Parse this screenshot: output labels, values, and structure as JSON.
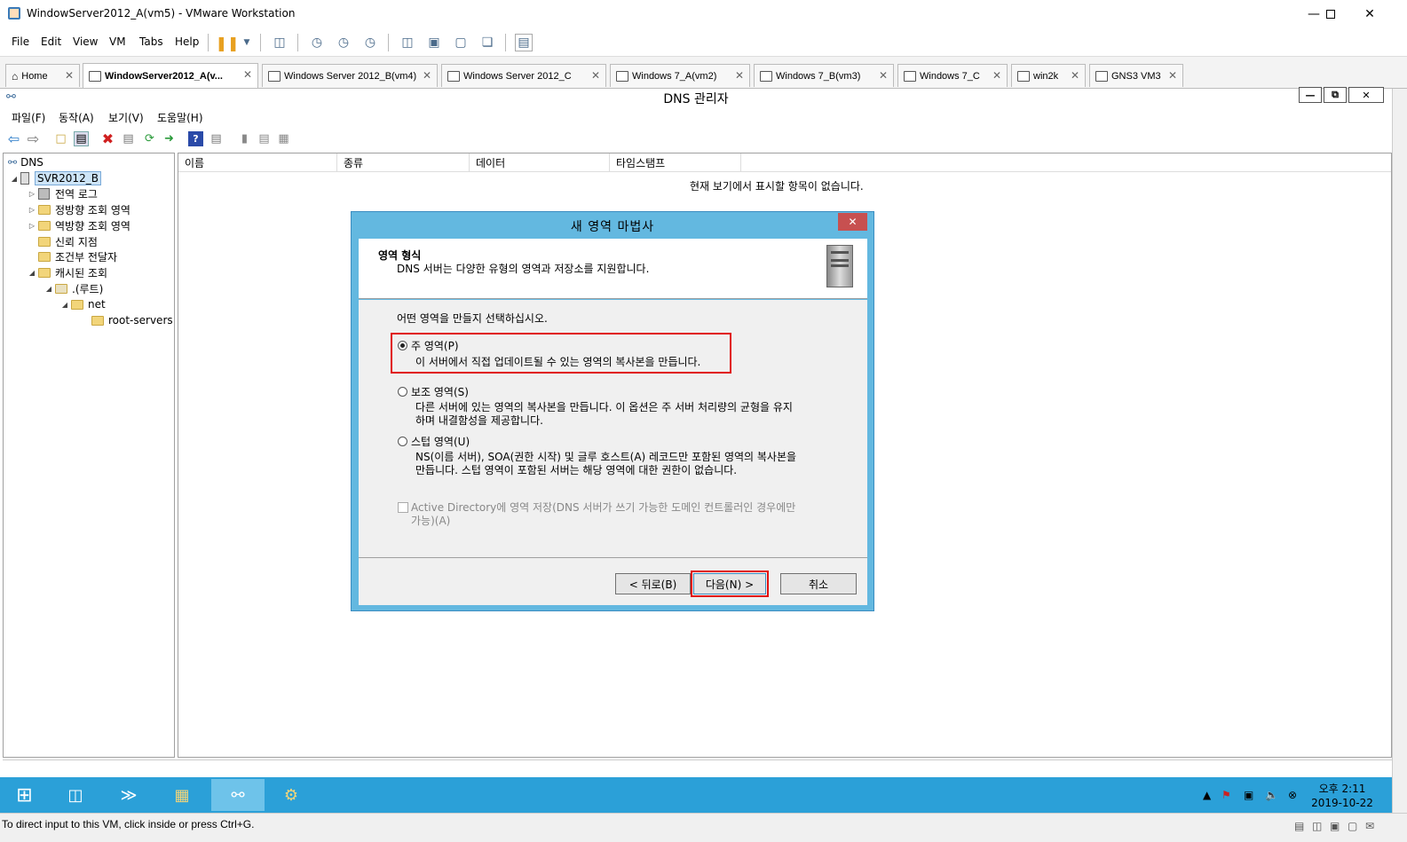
{
  "vmware": {
    "title": "WindowServer2012_A(vm5) - VMware Workstation",
    "menu": [
      "File",
      "Edit",
      "View",
      "VM",
      "Tabs",
      "Help"
    ],
    "tabs": [
      {
        "label": "Home"
      },
      {
        "label": "WindowServer2012_A(v..."
      },
      {
        "label": "Windows Server 2012_B(vm4)"
      },
      {
        "label": "Windows Server 2012_C"
      },
      {
        "label": "Windows 7_A(vm2)"
      },
      {
        "label": "Windows 7_B(vm3)"
      },
      {
        "label": "Windows 7_C"
      },
      {
        "label": "win2k"
      },
      {
        "label": "GNS3 VM3"
      }
    ],
    "status_text": "To direct input to this VM, click inside or press Ctrl+G."
  },
  "guest": {
    "window_title": "DNS 관리자",
    "menu": [
      "파일(F)",
      "동작(A)",
      "보기(V)",
      "도움말(H)"
    ],
    "tree": [
      {
        "label": "DNS"
      },
      {
        "label": "SVR2012_B"
      },
      {
        "label": "전역 로그"
      },
      {
        "label": "정방향 조회 영역"
      },
      {
        "label": "역방향 조회 영역"
      },
      {
        "label": "신뢰 지점"
      },
      {
        "label": "조건부 전달자"
      },
      {
        "label": "캐시된 조회"
      },
      {
        "label": ".(루트)"
      },
      {
        "label": "net"
      },
      {
        "label": "root-servers"
      }
    ],
    "columns": [
      "이름",
      "종류",
      "데이터",
      "타임스탬프"
    ],
    "empty_message": "현재 보기에서 표시할 항목이 없습니다.",
    "taskbar": {
      "time": "오후 2:11",
      "date": "2019-10-22"
    }
  },
  "wizard": {
    "title": "새 영역 마법사",
    "header_title": "영역 형식",
    "header_subtitle": "DNS 서버는 다양한 유형의 영역과 저장소를 지원합니다.",
    "prompt": "어떤 영역을 만들지 선택하십시오.",
    "options": [
      {
        "label": "주 영역(P)",
        "desc1": "이 서버에서 직접 업데이트될 수 있는 영역의 복사본을 만듭니다.",
        "desc2": "",
        "selected": true
      },
      {
        "label": "보조 영역(S)",
        "desc1": "다른 서버에 있는 영역의 복사본을 만듭니다. 이 옵션은 주 서버 처리량의 균형을 유지",
        "desc2": "하며 내결함성을 제공합니다.",
        "selected": false
      },
      {
        "label": "스텁 영역(U)",
        "desc1": "NS(이름 서버), SOA(권한 시작) 및 글루 호스트(A) 레코드만 포함된 영역의 복사본을",
        "desc2": "만듭니다. 스텁 영역이 포함된 서버는 해당 영역에 대한 권한이 없습니다.",
        "selected": false
      }
    ],
    "ad_checkbox_line1": "Active Directory에 영역 저장(DNS 서버가 쓰기 가능한 도메인 컨트롤러인 경우에만",
    "ad_checkbox_line2": "가능)(A)",
    "buttons": {
      "back": "< 뒤로(B)",
      "next": "다음(N) >",
      "cancel": "취소"
    },
    "colors": {
      "frame": "#63b8e0",
      "highlight": "#e01010"
    }
  }
}
